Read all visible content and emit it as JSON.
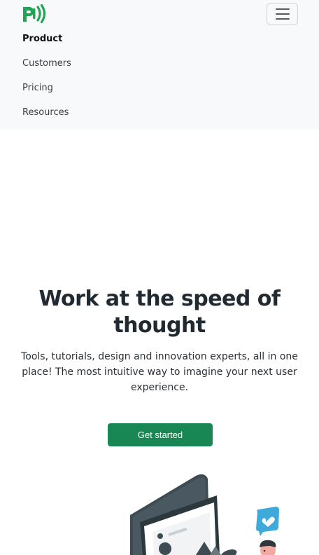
{
  "nav": {
    "items": [
      {
        "label": "Product",
        "active": true
      },
      {
        "label": "Customers",
        "active": false
      },
      {
        "label": "Pricing",
        "active": false
      },
      {
        "label": "Resources",
        "active": false
      }
    ]
  },
  "hero": {
    "title_line1": "Work at the speed of",
    "title_line2": "thought",
    "subtitle": "Tools, tutorials, design and innovation experts, all in one place! The most intuitive way to imagine your next user experience.",
    "cta_label": "Get started"
  },
  "colors": {
    "brand_green": "#23a455",
    "cta_green": "#198754",
    "navbar_bg": "#f8f9fa",
    "title_color": "#212a31"
  }
}
